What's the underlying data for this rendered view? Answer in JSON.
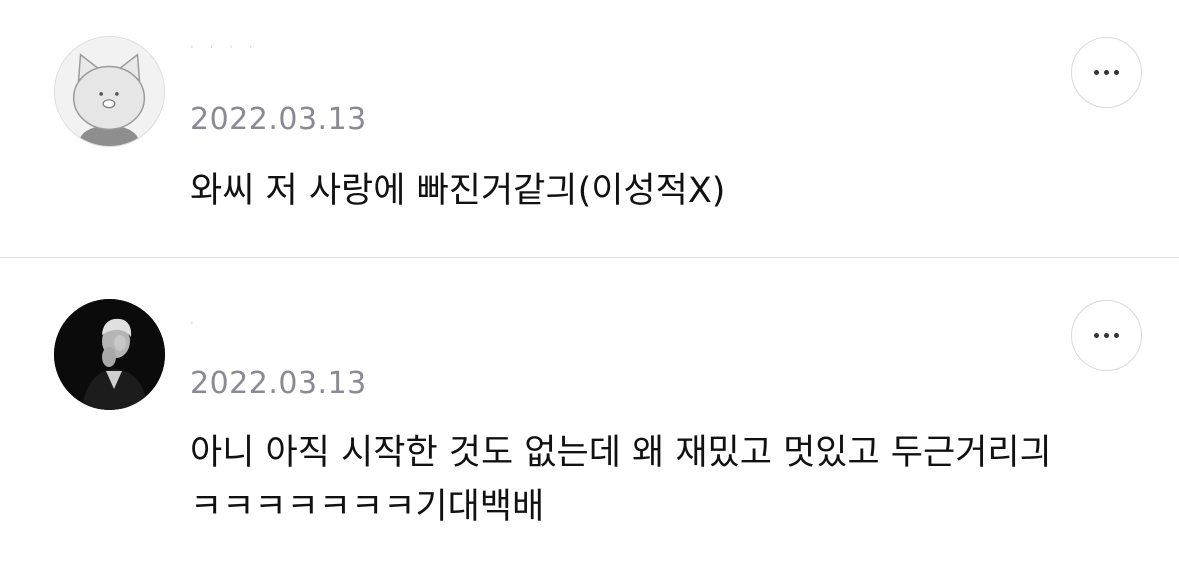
{
  "comments": [
    {
      "username": "· · · ·",
      "date": "2022.03.13",
      "text": "와씨 저 사랑에 빠진거같긔(이성적X)",
      "avatar_icon": "cat-avatar-icon",
      "more_icon": "more-options-icon"
    },
    {
      "username": "·",
      "date": "2022.03.13",
      "text": "아니 아직 시작한 것도 없는데 왜 재밌고 멋있고 두근거리긔 ㅋㅋㅋㅋㅋㅋㅋ기대백배",
      "avatar_icon": "person-photo-avatar-icon",
      "more_icon": "more-options-icon"
    }
  ],
  "colors": {
    "date_text": "#8a8a94",
    "body_text": "#111111",
    "divider": "#e3e3e3",
    "button_border": "#d9d9d9"
  }
}
